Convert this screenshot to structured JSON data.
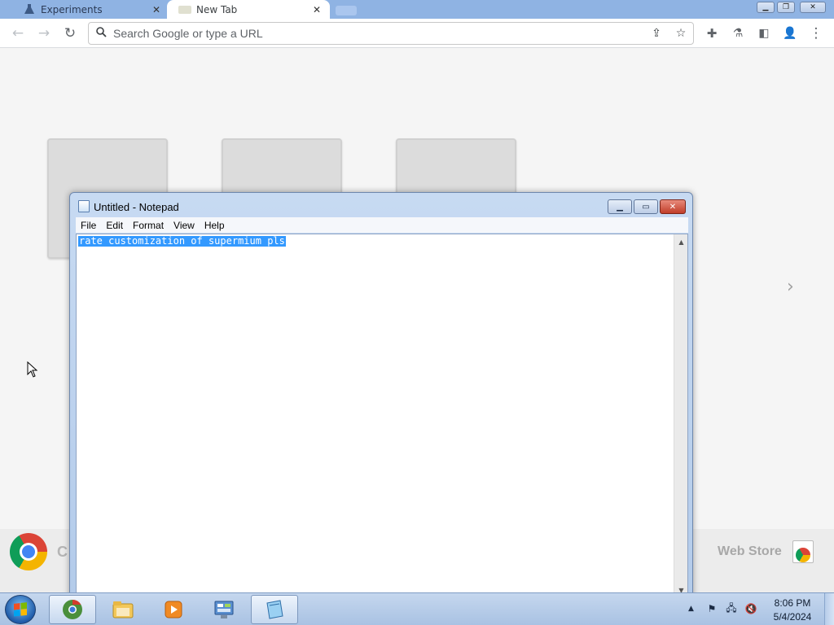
{
  "browser": {
    "tabs": [
      {
        "title": "Experiments",
        "icon": "flask-icon"
      },
      {
        "title": "New Tab",
        "icon": "new-tab-page-icon"
      }
    ],
    "omnibox_placeholder": "Search Google or type a URL",
    "ntp": {
      "bottom_apps_label": "C",
      "webstore_label": "Web Store"
    }
  },
  "notepad": {
    "title": "Untitled - Notepad",
    "menus": [
      "File",
      "Edit",
      "Format",
      "View",
      "Help"
    ],
    "content": "rate customization of supermium pls",
    "content_selected": true
  },
  "taskbar": {
    "pinned": [
      {
        "name": "chrome-icon"
      },
      {
        "name": "explorer-icon"
      },
      {
        "name": "media-player-icon"
      },
      {
        "name": "control-panel-icon"
      },
      {
        "name": "notepad-icon",
        "active": true
      }
    ],
    "clock_time": "8:06 PM",
    "clock_date": "5/4/2024"
  },
  "colors": {
    "selection": "#3399ff",
    "titlebar_blue": "#b9cfee",
    "close_red": "#c13e2a"
  }
}
